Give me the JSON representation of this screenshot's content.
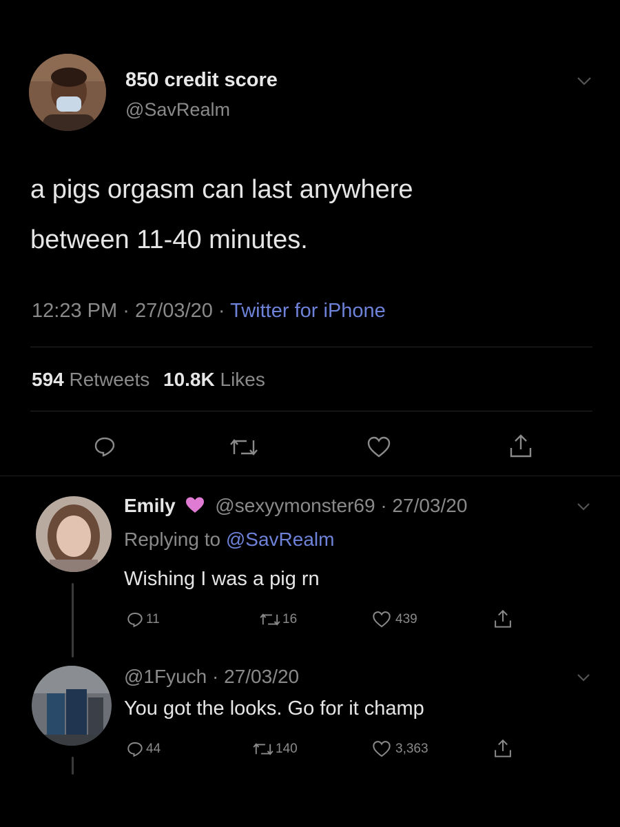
{
  "main_tweet": {
    "display_name": "850 credit score",
    "handle": "@SavRealm",
    "text_line1": "a pigs orgasm can last anywhere",
    "text_line2": "between 11-40 minutes.",
    "time": "12:23 PM",
    "date": "27/03/20",
    "sep1": "·",
    "sep2": "·",
    "source": "Twitter for iPhone",
    "retweets_count": "594",
    "retweets_label": "Retweets",
    "likes_count": "10.8K",
    "likes_label": "Likes"
  },
  "replies": [
    {
      "display_name": "Emily",
      "handle_date": "@sexyymonster69 · 27/03/20",
      "replying_label": "Replying to",
      "replying_handle": "@SavRealm",
      "text": "Wishing I was a pig rn",
      "reply_count": "11",
      "retweet_count": "16",
      "like_count": "439"
    },
    {
      "handle_date": "@1Fyuch · 27/03/20",
      "text": "You got the looks. Go for it champ",
      "reply_count": "44",
      "retweet_count": "140",
      "like_count": "3,363"
    }
  ],
  "colors": {
    "background": "#000000",
    "text": "#d9d9d9",
    "muted": "#8a8a8a",
    "link": "#6d82d8",
    "heart_emoji": "#e07bd4"
  },
  "icons": [
    "chevron-down-icon",
    "reply-icon",
    "retweet-icon",
    "like-icon",
    "share-icon",
    "purple-heart-icon"
  ]
}
